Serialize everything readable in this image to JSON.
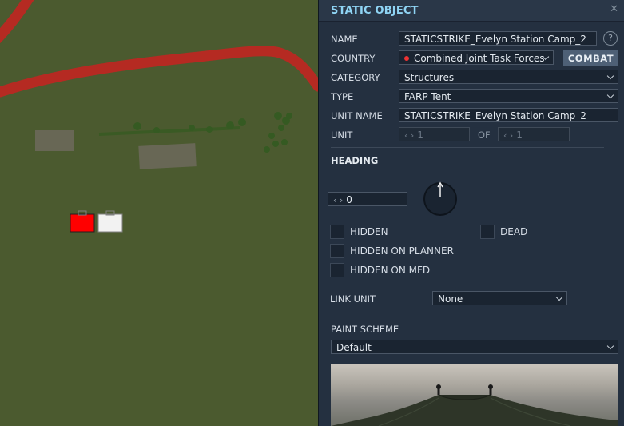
{
  "panel": {
    "title": "STATIC OBJECT",
    "close_icon": "close-icon",
    "name_label": "NAME",
    "name_value": "STATICSTRIKE_Evelyn Station Camp_2",
    "help_label": "?",
    "country_label": "COUNTRY",
    "country_value": "Combined Joint Task Forces",
    "combat_label": "COMBAT",
    "category_label": "CATEGORY",
    "category_value": "Structures",
    "type_label": "TYPE",
    "type_value": "FARP Tent",
    "unit_name_label": "UNIT NAME",
    "unit_name_value": "STATICSTRIKE_Evelyn Station Camp_2",
    "unit_label": "UNIT",
    "unit_value": "1",
    "of_label": "OF",
    "of_value": "1",
    "heading_label": "HEADING",
    "heading_value": "0",
    "hidden_label": "HIDDEN",
    "dead_label": "DEAD",
    "hidden_planner_label": "HIDDEN ON PLANNER",
    "hidden_mfd_label": "HIDDEN ON MFD",
    "link_unit_label": "LINK UNIT",
    "link_unit_value": "None",
    "paint_scheme_label": "PAINT SCHEME",
    "paint_scheme_value": "Default"
  },
  "colors": {
    "accent": "#8fd4f4",
    "map_ground": "#4b5a2f",
    "road": "#b52a22",
    "red_unit": "#ff0000",
    "blue_panel": "#243040"
  }
}
